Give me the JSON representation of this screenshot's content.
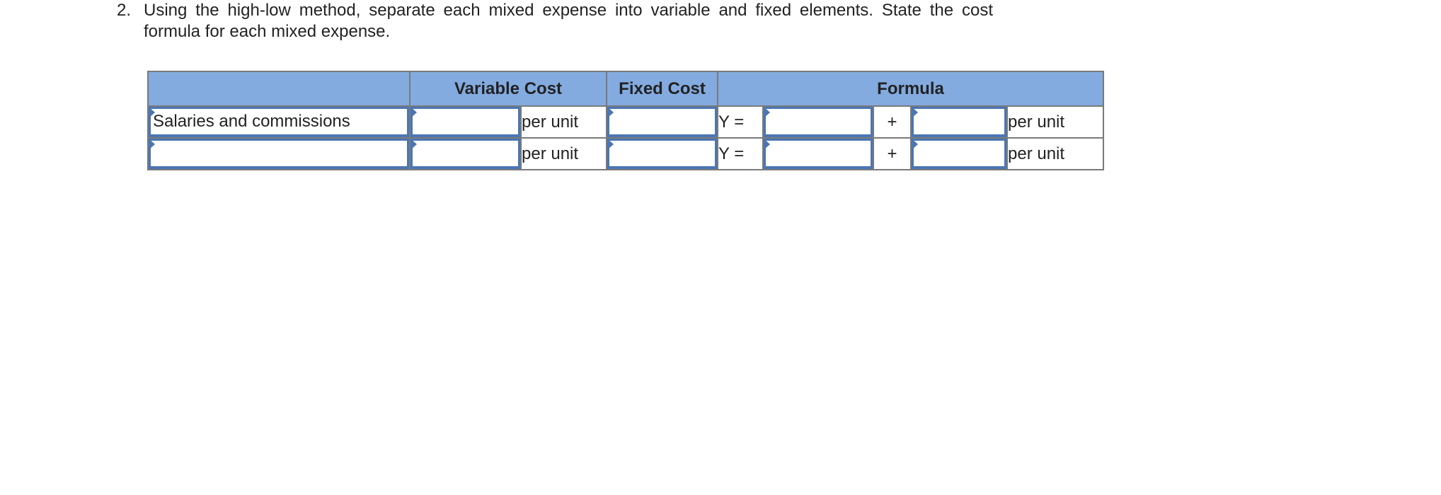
{
  "question": {
    "number": "2.",
    "text": "Using the high-low method, separate each mixed expense into variable and fixed elements. State the cost formula for each mixed expense."
  },
  "table": {
    "headers": {
      "label": "",
      "variable_cost": "Variable Cost",
      "fixed_cost": "Fixed Cost",
      "formula": "Formula"
    },
    "rows": [
      {
        "label_value": "Salaries and commissions",
        "variable_cost_value": "",
        "variable_unit": "per unit",
        "fixed_cost_value": "",
        "formula_prefix": "Y =",
        "formula_fixed_value": "",
        "formula_operator": "+",
        "formula_variable_value": "",
        "formula_unit": "per unit"
      },
      {
        "label_value": "",
        "variable_cost_value": "",
        "variable_unit": "per unit",
        "fixed_cost_value": "",
        "formula_prefix": "Y =",
        "formula_fixed_value": "",
        "formula_operator": "+",
        "formula_variable_value": "",
        "formula_unit": "per unit"
      }
    ]
  },
  "colors": {
    "header_bg": "#83abe0",
    "input_border": "#4a76b4",
    "grid_line": "#7a7a7a"
  }
}
